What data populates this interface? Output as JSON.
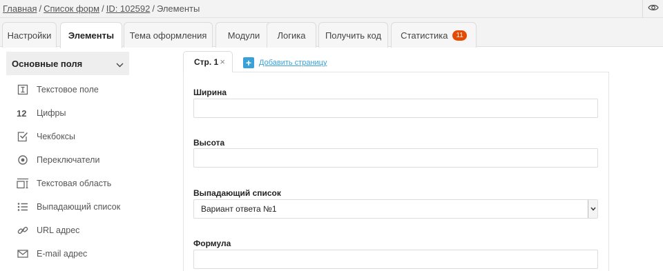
{
  "breadcrumb": {
    "home": "Главная",
    "forms": "Список форм",
    "id": "ID: 102592",
    "current": "Элементы"
  },
  "tabs": [
    {
      "label": "Настройки"
    },
    {
      "label": "Элементы"
    },
    {
      "label": "Тема оформления"
    },
    {
      "label": "Модули"
    },
    {
      "label": "Логика"
    },
    {
      "label": "Получить код"
    },
    {
      "label": "Статистика",
      "badge": "11"
    }
  ],
  "sidebar": {
    "group_title": "Основные поля",
    "items": [
      {
        "label": "Текстовое поле",
        "icon": "text-field-icon"
      },
      {
        "label": "Цифры",
        "icon_text": "12",
        "icon": "digits-icon"
      },
      {
        "label": "Чекбоксы",
        "icon": "checkbox-icon"
      },
      {
        "label": "Переключатели",
        "icon": "radio-icon"
      },
      {
        "label": "Текстовая область",
        "icon": "textarea-icon"
      },
      {
        "label": "Выпадающий список",
        "icon": "list-icon"
      },
      {
        "label": "URL адрес",
        "icon": "link-icon"
      },
      {
        "label": "E-mail адрес",
        "icon": "mail-icon"
      }
    ]
  },
  "pages": {
    "page1": "Стр. 1",
    "close": "×",
    "add_page": "Добавить страницу"
  },
  "form": {
    "fields": [
      {
        "label": "Ширина",
        "type": "text",
        "value": ""
      },
      {
        "label": "Высота",
        "type": "text",
        "value": ""
      },
      {
        "label": "Выпадающий список",
        "type": "select",
        "value": "Вариант ответа №1"
      },
      {
        "label": "Формула",
        "type": "text",
        "value": ""
      }
    ]
  },
  "colors": {
    "accent": "#3aa0d8",
    "badge": "#e64a00"
  }
}
